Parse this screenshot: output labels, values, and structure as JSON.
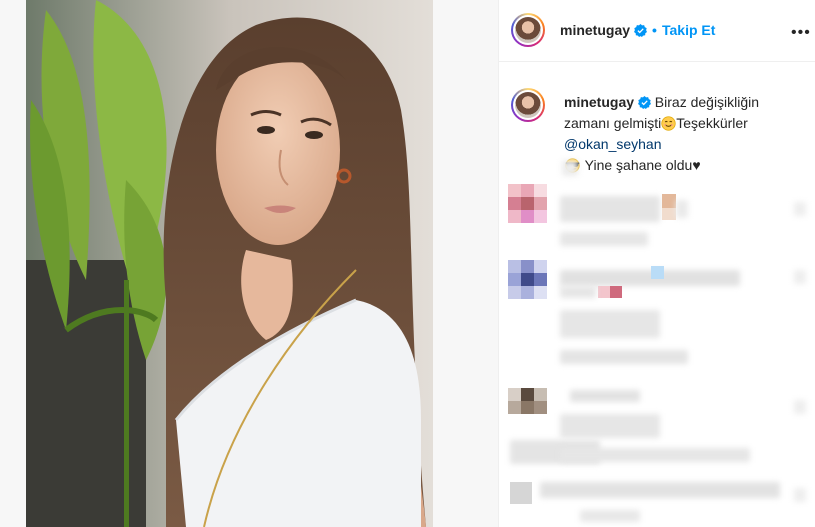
{
  "post": {
    "username": "minetugay",
    "follow_separator": "•",
    "follow_label": "Takip Et",
    "more_icon": "more-horizontal-icon",
    "verified_icon": "verified-badge-icon"
  },
  "caption": {
    "username": "minetugay",
    "text_part1": "Biraz değişikliğin zamanı gelmişti",
    "text_part2": "Teşekkürler",
    "mention": "@okan_seyhan",
    "text_part3": "Yine şahane oldu♥",
    "emoji_1": "smiling-face-icon",
    "emoji_2": "sunglasses-face-icon"
  },
  "colors": {
    "accent": "#0095f6",
    "mention": "#00376b",
    "text": "#262626"
  }
}
